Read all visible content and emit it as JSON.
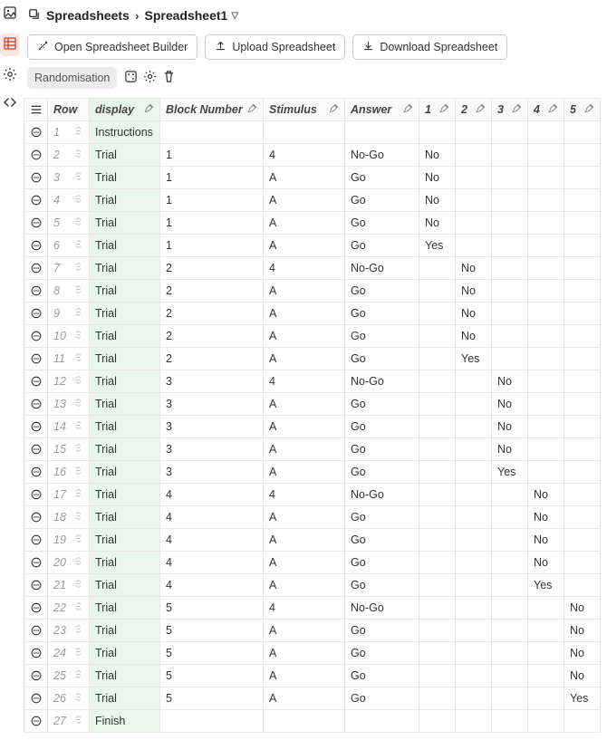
{
  "breadcrumb": {
    "root": "Spreadsheets",
    "current": "Spreadsheet1"
  },
  "toolbar": {
    "open_builder": "Open Spreadsheet Builder",
    "upload": "Upload Spreadsheet",
    "download": "Download Spreadsheet",
    "randomisation": "Randomisation"
  },
  "headers": {
    "row": "Row",
    "display": "display",
    "block": "Block Number",
    "stimulus": "Stimulus",
    "answer": "Answer",
    "c1": "1",
    "c2": "2",
    "c3": "3",
    "c4": "4",
    "c5": "5"
  },
  "rows": [
    {
      "n": "1",
      "display": "Instructions",
      "block": "",
      "stim": "",
      "ans": "",
      "c1": "",
      "c2": "",
      "c3": "",
      "c4": "",
      "c5": ""
    },
    {
      "n": "2",
      "display": "Trial",
      "block": "1",
      "stim": "4",
      "ans": "No-Go",
      "c1": "No",
      "c2": "",
      "c3": "",
      "c4": "",
      "c5": ""
    },
    {
      "n": "3",
      "display": "Trial",
      "block": "1",
      "stim": "A",
      "ans": "Go",
      "c1": "No",
      "c2": "",
      "c3": "",
      "c4": "",
      "c5": ""
    },
    {
      "n": "4",
      "display": "Trial",
      "block": "1",
      "stim": "A",
      "ans": "Go",
      "c1": "No",
      "c2": "",
      "c3": "",
      "c4": "",
      "c5": ""
    },
    {
      "n": "5",
      "display": "Trial",
      "block": "1",
      "stim": "A",
      "ans": "Go",
      "c1": "No",
      "c2": "",
      "c3": "",
      "c4": "",
      "c5": ""
    },
    {
      "n": "6",
      "display": "Trial",
      "block": "1",
      "stim": "A",
      "ans": "Go",
      "c1": "Yes",
      "c2": "",
      "c3": "",
      "c4": "",
      "c5": ""
    },
    {
      "n": "7",
      "display": "Trial",
      "block": "2",
      "stim": "4",
      "ans": "No-Go",
      "c1": "",
      "c2": "No",
      "c3": "",
      "c4": "",
      "c5": ""
    },
    {
      "n": "8",
      "display": "Trial",
      "block": "2",
      "stim": "A",
      "ans": "Go",
      "c1": "",
      "c2": "No",
      "c3": "",
      "c4": "",
      "c5": ""
    },
    {
      "n": "9",
      "display": "Trial",
      "block": "2",
      "stim": "A",
      "ans": "Go",
      "c1": "",
      "c2": "No",
      "c3": "",
      "c4": "",
      "c5": ""
    },
    {
      "n": "10",
      "display": "Trial",
      "block": "2",
      "stim": "A",
      "ans": "Go",
      "c1": "",
      "c2": "No",
      "c3": "",
      "c4": "",
      "c5": ""
    },
    {
      "n": "11",
      "display": "Trial",
      "block": "2",
      "stim": "A",
      "ans": "Go",
      "c1": "",
      "c2": "Yes",
      "c3": "",
      "c4": "",
      "c5": ""
    },
    {
      "n": "12",
      "display": "Trial",
      "block": "3",
      "stim": "4",
      "ans": "No-Go",
      "c1": "",
      "c2": "",
      "c3": "No",
      "c4": "",
      "c5": ""
    },
    {
      "n": "13",
      "display": "Trial",
      "block": "3",
      "stim": "A",
      "ans": "Go",
      "c1": "",
      "c2": "",
      "c3": "No",
      "c4": "",
      "c5": ""
    },
    {
      "n": "14",
      "display": "Trial",
      "block": "3",
      "stim": "A",
      "ans": "Go",
      "c1": "",
      "c2": "",
      "c3": "No",
      "c4": "",
      "c5": ""
    },
    {
      "n": "15",
      "display": "Trial",
      "block": "3",
      "stim": "A",
      "ans": "Go",
      "c1": "",
      "c2": "",
      "c3": "No",
      "c4": "",
      "c5": ""
    },
    {
      "n": "16",
      "display": "Trial",
      "block": "3",
      "stim": "A",
      "ans": "Go",
      "c1": "",
      "c2": "",
      "c3": "Yes",
      "c4": "",
      "c5": ""
    },
    {
      "n": "17",
      "display": "Trial",
      "block": "4",
      "stim": "4",
      "ans": "No-Go",
      "c1": "",
      "c2": "",
      "c3": "",
      "c4": "No",
      "c5": ""
    },
    {
      "n": "18",
      "display": "Trial",
      "block": "4",
      "stim": "A",
      "ans": "Go",
      "c1": "",
      "c2": "",
      "c3": "",
      "c4": "No",
      "c5": ""
    },
    {
      "n": "19",
      "display": "Trial",
      "block": "4",
      "stim": "A",
      "ans": "Go",
      "c1": "",
      "c2": "",
      "c3": "",
      "c4": "No",
      "c5": ""
    },
    {
      "n": "20",
      "display": "Trial",
      "block": "4",
      "stim": "A",
      "ans": "Go",
      "c1": "",
      "c2": "",
      "c3": "",
      "c4": "No",
      "c5": ""
    },
    {
      "n": "21",
      "display": "Trial",
      "block": "4",
      "stim": "A",
      "ans": "Go",
      "c1": "",
      "c2": "",
      "c3": "",
      "c4": "Yes",
      "c5": ""
    },
    {
      "n": "22",
      "display": "Trial",
      "block": "5",
      "stim": "4",
      "ans": "No-Go",
      "c1": "",
      "c2": "",
      "c3": "",
      "c4": "",
      "c5": "No"
    },
    {
      "n": "23",
      "display": "Trial",
      "block": "5",
      "stim": "A",
      "ans": "Go",
      "c1": "",
      "c2": "",
      "c3": "",
      "c4": "",
      "c5": "No"
    },
    {
      "n": "24",
      "display": "Trial",
      "block": "5",
      "stim": "A",
      "ans": "Go",
      "c1": "",
      "c2": "",
      "c3": "",
      "c4": "",
      "c5": "No"
    },
    {
      "n": "25",
      "display": "Trial",
      "block": "5",
      "stim": "A",
      "ans": "Go",
      "c1": "",
      "c2": "",
      "c3": "",
      "c4": "",
      "c5": "No"
    },
    {
      "n": "26",
      "display": "Trial",
      "block": "5",
      "stim": "A",
      "ans": "Go",
      "c1": "",
      "c2": "",
      "c3": "",
      "c4": "",
      "c5": "Yes"
    },
    {
      "n": "27",
      "display": "Finish",
      "block": "",
      "stim": "",
      "ans": "",
      "c1": "",
      "c2": "",
      "c3": "",
      "c4": "",
      "c5": ""
    }
  ]
}
